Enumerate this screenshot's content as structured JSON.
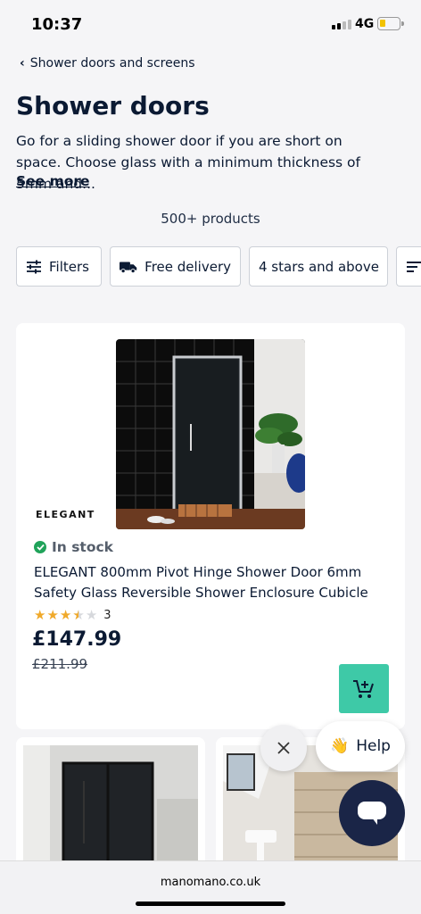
{
  "status_bar": {
    "time": "10:37",
    "network": "4G"
  },
  "breadcrumb": {
    "label": "Shower doors and screens"
  },
  "page": {
    "title": "Shower doors",
    "description": "Go for a sliding shower door if you are short on space. Choose glass with a minimum thickness of 5mm and...",
    "see_more": "See more",
    "product_count": "500+ products"
  },
  "filters": {
    "filters_label": "Filters",
    "free_delivery_label": "Free delivery",
    "stars_label": "4 stars and above"
  },
  "product": {
    "brand": "ELEGANT",
    "stock": "In stock",
    "name": "ELEGANT 800mm Pivot Hinge Shower Door 6mm Safety Glass Reversible Shower Enclosure Cubicle",
    "rating": 3.5,
    "rating_max": 5,
    "review_count": "3",
    "price": "£147.99",
    "old_price": "£211.99"
  },
  "chat": {
    "help_label": "Help",
    "help_emoji": "👋"
  },
  "browser": {
    "url": "manomano.co.uk"
  },
  "colors": {
    "accent": "#3ec9a7",
    "navy": "#0b1a33",
    "stock_green": "#20a35a",
    "star": "#f0a92a",
    "chat_bg": "#1a2547"
  }
}
